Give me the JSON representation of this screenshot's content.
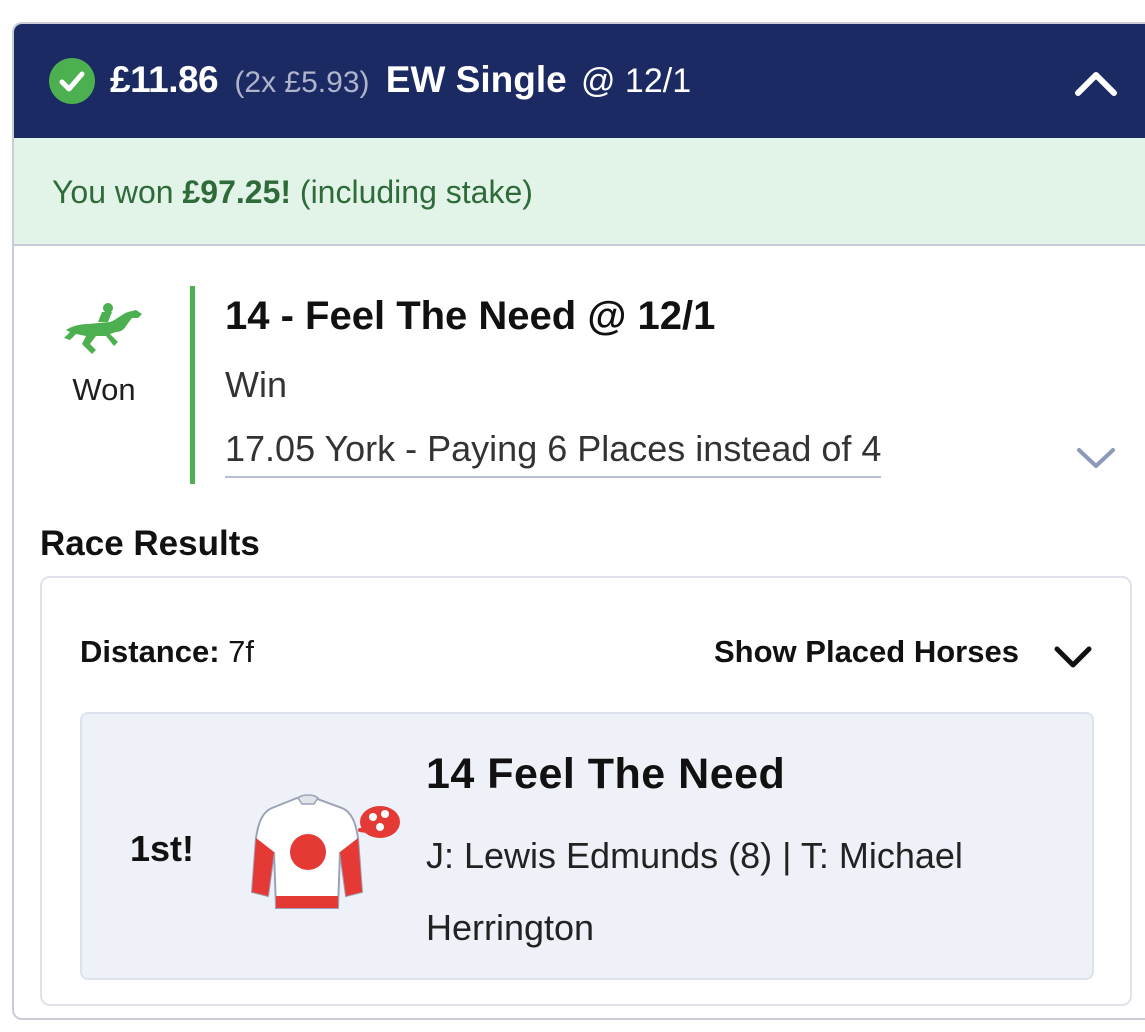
{
  "header": {
    "stake": "£11.86",
    "split": "(2x £5.93)",
    "bet_type": "EW Single",
    "odds": "@ 12/1"
  },
  "banner": {
    "prefix": "You won",
    "amount": "£97.25!",
    "suffix": "(including stake)"
  },
  "selection": {
    "status": "Won",
    "title": "14 - Feel The Need @ 12/1",
    "market": "Win",
    "race": "17.05 York - Paying 6 Places instead of 4"
  },
  "race_results": {
    "title": "Race Results",
    "distance_label": "Distance:",
    "distance_value": "7f",
    "show_placed_label": "Show Placed Horses",
    "result": {
      "position": "1st!",
      "horse": "14 Feel The Need",
      "jockey_trainer": "J: Lewis Edmunds (8) | T: Michael Herrington"
    }
  },
  "colors": {
    "header_bg": "#1c2a63",
    "success_green": "#4caf50",
    "banner_bg": "#e2f3e7",
    "banner_text": "#2f6b3a",
    "result_bg": "#eef1f8",
    "silks_red": "#e53935"
  },
  "icons": {
    "status": "check-circle-icon",
    "collapse": "chevron-up-icon",
    "selection": "racehorse-icon",
    "expand": "chevron-down-icon",
    "silks": "jockey-silks-icon"
  }
}
